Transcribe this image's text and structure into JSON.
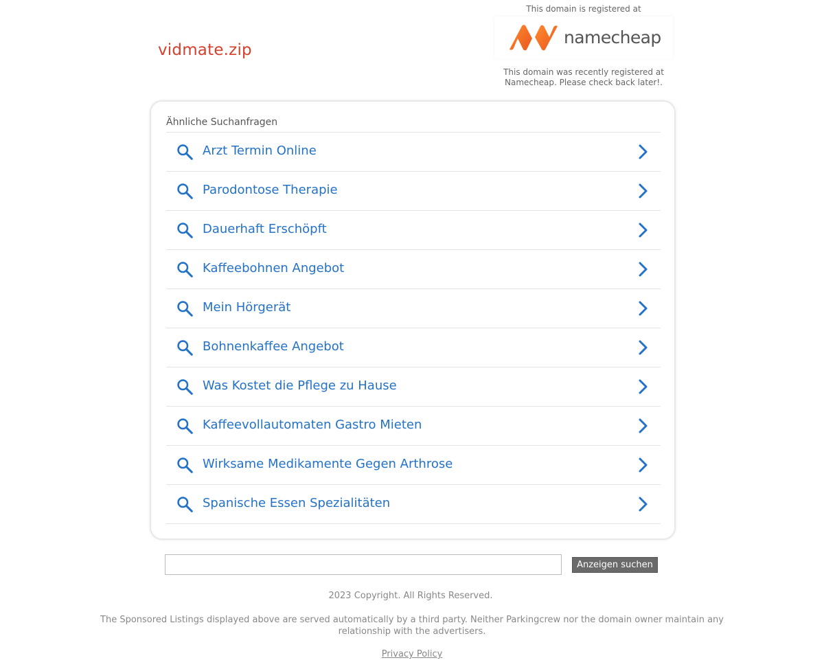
{
  "domain": {
    "name": "vidmate.zip"
  },
  "registrar": {
    "top_text": "This domain is registered at",
    "logo_name": "namecheap",
    "bottom_text": "This domain was recently registered at Namecheap. Please check back later!."
  },
  "related": {
    "heading": "Ähnliche Suchanfragen",
    "items": [
      {
        "label": "Arzt Termin Online"
      },
      {
        "label": "Parodontose Therapie"
      },
      {
        "label": "Dauerhaft Erschöpft"
      },
      {
        "label": "Kaffeebohnen Angebot"
      },
      {
        "label": "Mein Hörgerät"
      },
      {
        "label": "Bohnenkaffee Angebot"
      },
      {
        "label": "Was Kostet die Pflege zu Hause"
      },
      {
        "label": "Kaffeevollautomaten Gastro Mieten"
      },
      {
        "label": "Wirksame Medikamente Gegen Arthrose"
      },
      {
        "label": "Spanische Essen Spezialitäten"
      }
    ]
  },
  "search": {
    "value": "",
    "button_label": "Anzeigen suchen"
  },
  "footer": {
    "copyright": "2023 Copyright. All Rights Reserved.",
    "disclaimer": "The Sponsored Listings displayed above are served automatically by a third party. Neither Parkingcrew nor the domain owner maintain any relationship with the advertisers.",
    "privacy_label": "Privacy Policy"
  },
  "colors": {
    "domain_title": "#d6402c",
    "link": "#2472c8",
    "button_bg": "#6a6a6a",
    "logo_orange": "#f26b21"
  },
  "icons": {
    "item_left": "search-icon",
    "item_right": "chevron-right-icon"
  }
}
